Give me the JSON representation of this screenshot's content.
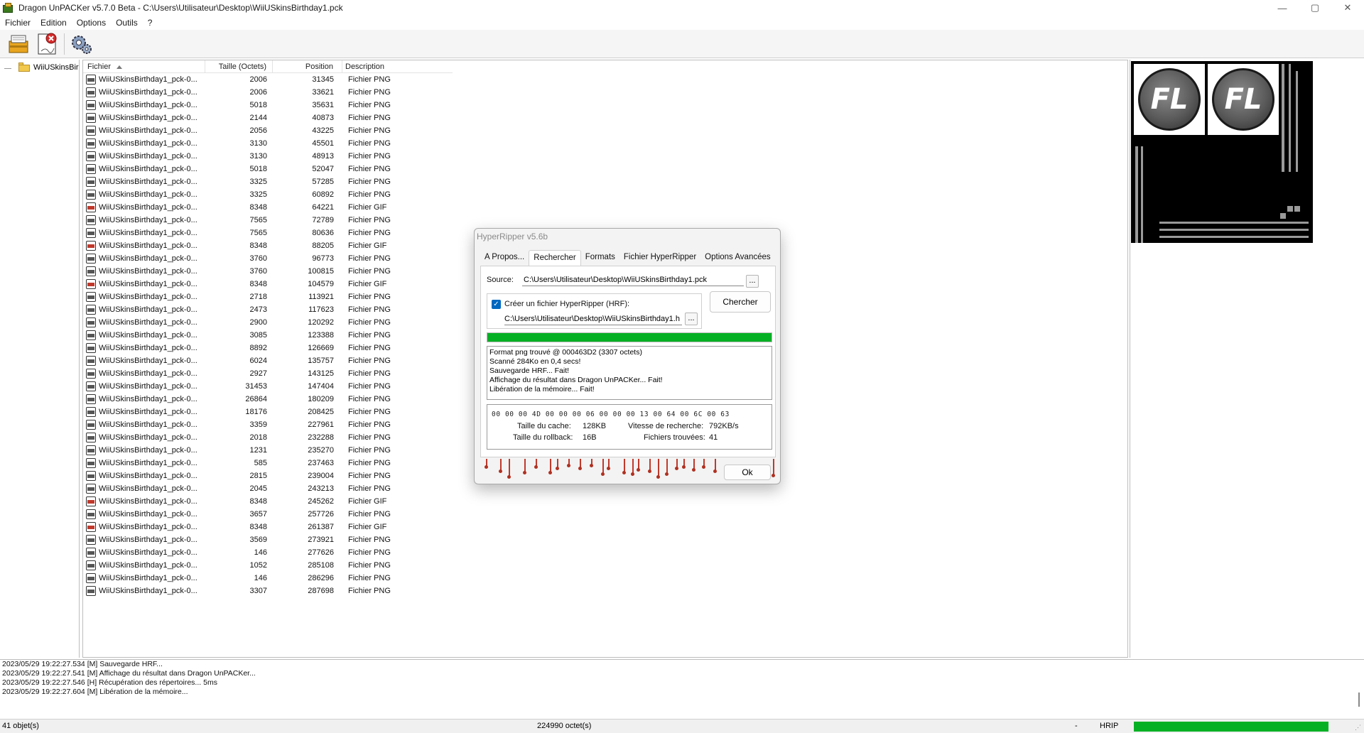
{
  "window": {
    "title": "Dragon UnPACKer v5.7.0 Beta - C:\\Users\\Utilisateur\\Desktop\\WiiUSkinsBirthday1.pck",
    "controls": {
      "minimize": "—",
      "maximize": "▢",
      "close": "✕"
    }
  },
  "menu": [
    "Fichier",
    "Edition",
    "Options",
    "Outils",
    "?"
  ],
  "toolbar": {
    "icons": [
      "open-archive-icon",
      "close-archive-icon",
      "settings-gears-icon"
    ]
  },
  "tree": {
    "root_label": "WiiUSkinsBir"
  },
  "filelist": {
    "headers": {
      "name": "Fichier",
      "size": "Taille (Octets)",
      "position": "Position",
      "description": "Description"
    },
    "rows": [
      {
        "name": "WiiUSkinsBirthday1_pck-0...",
        "size": "2006",
        "pos": "31345",
        "desc": "Fichier PNG",
        "kind": "png"
      },
      {
        "name": "WiiUSkinsBirthday1_pck-0...",
        "size": "2006",
        "pos": "33621",
        "desc": "Fichier PNG",
        "kind": "png"
      },
      {
        "name": "WiiUSkinsBirthday1_pck-0...",
        "size": "5018",
        "pos": "35631",
        "desc": "Fichier PNG",
        "kind": "png"
      },
      {
        "name": "WiiUSkinsBirthday1_pck-0...",
        "size": "2144",
        "pos": "40873",
        "desc": "Fichier PNG",
        "kind": "png"
      },
      {
        "name": "WiiUSkinsBirthday1_pck-0...",
        "size": "2056",
        "pos": "43225",
        "desc": "Fichier PNG",
        "kind": "png"
      },
      {
        "name": "WiiUSkinsBirthday1_pck-0...",
        "size": "3130",
        "pos": "45501",
        "desc": "Fichier PNG",
        "kind": "png"
      },
      {
        "name": "WiiUSkinsBirthday1_pck-0...",
        "size": "3130",
        "pos": "48913",
        "desc": "Fichier PNG",
        "kind": "png"
      },
      {
        "name": "WiiUSkinsBirthday1_pck-0...",
        "size": "5018",
        "pos": "52047",
        "desc": "Fichier PNG",
        "kind": "png"
      },
      {
        "name": "WiiUSkinsBirthday1_pck-0...",
        "size": "3325",
        "pos": "57285",
        "desc": "Fichier PNG",
        "kind": "png"
      },
      {
        "name": "WiiUSkinsBirthday1_pck-0...",
        "size": "3325",
        "pos": "60892",
        "desc": "Fichier PNG",
        "kind": "png"
      },
      {
        "name": "WiiUSkinsBirthday1_pck-0...",
        "size": "8348",
        "pos": "64221",
        "desc": "Fichier GIF",
        "kind": "gif"
      },
      {
        "name": "WiiUSkinsBirthday1_pck-0...",
        "size": "7565",
        "pos": "72789",
        "desc": "Fichier PNG",
        "kind": "png"
      },
      {
        "name": "WiiUSkinsBirthday1_pck-0...",
        "size": "7565",
        "pos": "80636",
        "desc": "Fichier PNG",
        "kind": "png"
      },
      {
        "name": "WiiUSkinsBirthday1_pck-0...",
        "size": "8348",
        "pos": "88205",
        "desc": "Fichier GIF",
        "kind": "gif"
      },
      {
        "name": "WiiUSkinsBirthday1_pck-0...",
        "size": "3760",
        "pos": "96773",
        "desc": "Fichier PNG",
        "kind": "png"
      },
      {
        "name": "WiiUSkinsBirthday1_pck-0...",
        "size": "3760",
        "pos": "100815",
        "desc": "Fichier PNG",
        "kind": "png"
      },
      {
        "name": "WiiUSkinsBirthday1_pck-0...",
        "size": "8348",
        "pos": "104579",
        "desc": "Fichier GIF",
        "kind": "gif"
      },
      {
        "name": "WiiUSkinsBirthday1_pck-0...",
        "size": "2718",
        "pos": "113921",
        "desc": "Fichier PNG",
        "kind": "png"
      },
      {
        "name": "WiiUSkinsBirthday1_pck-0...",
        "size": "2473",
        "pos": "117623",
        "desc": "Fichier PNG",
        "kind": "png"
      },
      {
        "name": "WiiUSkinsBirthday1_pck-0...",
        "size": "2900",
        "pos": "120292",
        "desc": "Fichier PNG",
        "kind": "png"
      },
      {
        "name": "WiiUSkinsBirthday1_pck-0...",
        "size": "3085",
        "pos": "123388",
        "desc": "Fichier PNG",
        "kind": "png"
      },
      {
        "name": "WiiUSkinsBirthday1_pck-0...",
        "size": "8892",
        "pos": "126669",
        "desc": "Fichier PNG",
        "kind": "png"
      },
      {
        "name": "WiiUSkinsBirthday1_pck-0...",
        "size": "6024",
        "pos": "135757",
        "desc": "Fichier PNG",
        "kind": "png"
      },
      {
        "name": "WiiUSkinsBirthday1_pck-0...",
        "size": "2927",
        "pos": "143125",
        "desc": "Fichier PNG",
        "kind": "png"
      },
      {
        "name": "WiiUSkinsBirthday1_pck-0...",
        "size": "31453",
        "pos": "147404",
        "desc": "Fichier PNG",
        "kind": "png"
      },
      {
        "name": "WiiUSkinsBirthday1_pck-0...",
        "size": "26864",
        "pos": "180209",
        "desc": "Fichier PNG",
        "kind": "png"
      },
      {
        "name": "WiiUSkinsBirthday1_pck-0...",
        "size": "18176",
        "pos": "208425",
        "desc": "Fichier PNG",
        "kind": "png"
      },
      {
        "name": "WiiUSkinsBirthday1_pck-0...",
        "size": "3359",
        "pos": "227961",
        "desc": "Fichier PNG",
        "kind": "png"
      },
      {
        "name": "WiiUSkinsBirthday1_pck-0...",
        "size": "2018",
        "pos": "232288",
        "desc": "Fichier PNG",
        "kind": "png"
      },
      {
        "name": "WiiUSkinsBirthday1_pck-0...",
        "size": "1231",
        "pos": "235270",
        "desc": "Fichier PNG",
        "kind": "png"
      },
      {
        "name": "WiiUSkinsBirthday1_pck-0...",
        "size": "585",
        "pos": "237463",
        "desc": "Fichier PNG",
        "kind": "png"
      },
      {
        "name": "WiiUSkinsBirthday1_pck-0...",
        "size": "2815",
        "pos": "239004",
        "desc": "Fichier PNG",
        "kind": "png"
      },
      {
        "name": "WiiUSkinsBirthday1_pck-0...",
        "size": "2045",
        "pos": "243213",
        "desc": "Fichier PNG",
        "kind": "png"
      },
      {
        "name": "WiiUSkinsBirthday1_pck-0...",
        "size": "8348",
        "pos": "245262",
        "desc": "Fichier GIF",
        "kind": "gif"
      },
      {
        "name": "WiiUSkinsBirthday1_pck-0...",
        "size": "3657",
        "pos": "257726",
        "desc": "Fichier PNG",
        "kind": "png"
      },
      {
        "name": "WiiUSkinsBirthday1_pck-0...",
        "size": "8348",
        "pos": "261387",
        "desc": "Fichier GIF",
        "kind": "gif"
      },
      {
        "name": "WiiUSkinsBirthday1_pck-0...",
        "size": "3569",
        "pos": "273921",
        "desc": "Fichier PNG",
        "kind": "png"
      },
      {
        "name": "WiiUSkinsBirthday1_pck-0...",
        "size": "146",
        "pos": "277626",
        "desc": "Fichier PNG",
        "kind": "png"
      },
      {
        "name": "WiiUSkinsBirthday1_pck-0...",
        "size": "1052",
        "pos": "285108",
        "desc": "Fichier PNG",
        "kind": "png"
      },
      {
        "name": "WiiUSkinsBirthday1_pck-0...",
        "size": "146",
        "pos": "286296",
        "desc": "Fichier PNG",
        "kind": "png"
      },
      {
        "name": "WiiUSkinsBirthday1_pck-0...",
        "size": "3307",
        "pos": "287698",
        "desc": "Fichier PNG",
        "kind": "png"
      }
    ]
  },
  "preview": {
    "logo_text": "FL"
  },
  "dialog": {
    "title": "HyperRipper v5.6b",
    "tabs": [
      "A Propos...",
      "Rechercher",
      "Formats",
      "Fichier HyperRipper",
      "Options Avancées"
    ],
    "active_tab": "Rechercher",
    "source_label": "Source:",
    "source_value": "C:\\Users\\Utilisateur\\Desktop\\WiiUSkinsBirthday1.pck",
    "browse_label": "...",
    "hrf_checkbox_label": "Créer un fichier HyperRipper (HRF):",
    "hrf_checked": true,
    "hrf_value": "C:\\Users\\Utilisateur\\Desktop\\WiiUSkinsBirthday1.h",
    "search_button": "Chercher",
    "progress": 1.0,
    "progress_color": "#06b025",
    "log": [
      "Format png trouvé @ 000463D2 (3307 octets)",
      "Scanné 284Ko en 0,4 secs!",
      "Sauvegarde HRF... Fait!",
      "Affichage du résultat dans Dragon UnPACKer... Fait!",
      "Libération de la mémoire... Fait!"
    ],
    "hex": "00 00 00 4D 00 00 00 06 00 00 00 13 00 64 00 6C 00 63",
    "stats": {
      "cache_label": "Taille du cache:",
      "cache_value": "128KB",
      "speed_label": "Vitesse de recherche:",
      "speed_value": "792KB/s",
      "rollback_label": "Taille du rollback:",
      "rollback_value": "16B",
      "found_label": "Fichiers trouvées:",
      "found_value": "41"
    },
    "ok_button": "Ok"
  },
  "log": [
    "2023/05/29 19:22:27.534 [M] Sauvegarde HRF...",
    "2023/05/29 19:22:27.541 [M] Affichage du résultat dans Dragon UnPACKer...",
    "2023/05/29 19:22:27.546 [H] Récupération des répertoires... 5ms",
    "2023/05/29 19:22:27.604 [M] Libération de la mémoire..."
  ],
  "status": {
    "objects": "41 objet(s)",
    "bytes": "224990 octet(s)",
    "dash": "-",
    "plugin": "HRIP",
    "progress": 1.0,
    "progress_color": "#06b025"
  }
}
